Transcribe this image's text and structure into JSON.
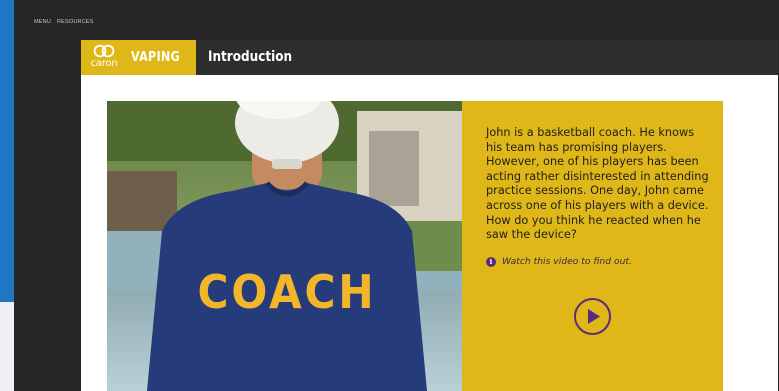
{
  "nav": {
    "menu": "MENU",
    "resources": "RESOURCES"
  },
  "header": {
    "logo_word": "caron",
    "brand_title": "VAPING",
    "page_title": "Introduction"
  },
  "photo": {
    "shirt_text": "COACH"
  },
  "card": {
    "story": "John is a basketball coach. He knows his team has promising players. However, one of his players has been acting rather disinterested in attending practice sessions. One day, John came across one of his players with a device. How do you think he reacted when he saw the device?",
    "hint": "Watch this video to find out.",
    "info_icon_glyph": "i"
  },
  "colors": {
    "brand_yellow": "#dfb719",
    "header_dark": "#2e2e2e",
    "accent_purple": "#5b2a7a",
    "shirt_navy": "#263c7a",
    "shirt_lettering": "#f3b52a"
  },
  "icons": [
    "caron-logo-icon",
    "info-icon",
    "play-icon"
  ]
}
